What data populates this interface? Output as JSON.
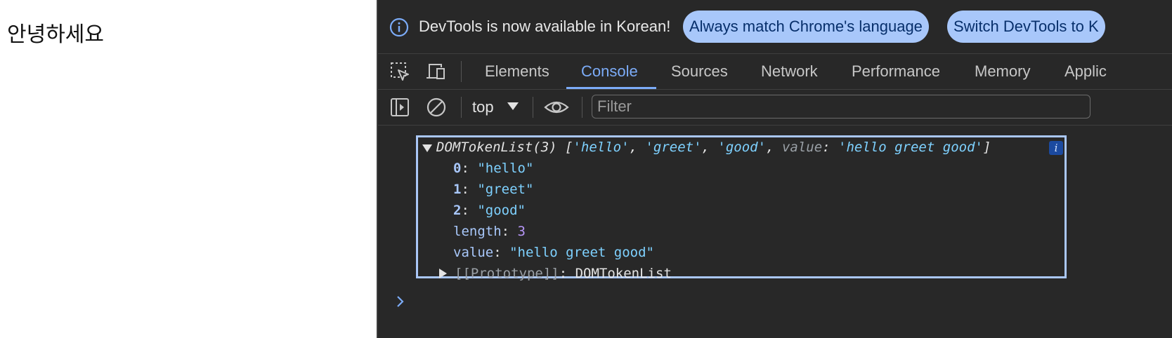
{
  "page": {
    "text": "안녕하세요"
  },
  "infobar": {
    "message": "DevTools is now available in Korean!",
    "button_match": "Always match Chrome's language",
    "button_switch": "Switch DevTools to K"
  },
  "tabs": [
    {
      "label": "Elements"
    },
    {
      "label": "Console"
    },
    {
      "label": "Sources"
    },
    {
      "label": "Network"
    },
    {
      "label": "Performance"
    },
    {
      "label": "Memory"
    },
    {
      "label": "Applic"
    }
  ],
  "active_tab": "Console",
  "console_toolbar": {
    "context": "top",
    "filter_placeholder": "Filter"
  },
  "console_entry": {
    "header": {
      "type": "DOMTokenList(3)",
      "open_bracket": " [",
      "item0": "'hello'",
      "item1": "'greet'",
      "item2": "'good'",
      "comma": ", ",
      "value_key": "value",
      "colon": ": ",
      "value_val": "'hello greet good'",
      "close_bracket": "]",
      "info_badge": "i"
    },
    "props": [
      {
        "key": "0",
        "value": "\"hello\""
      },
      {
        "key": "1",
        "value": "\"greet\""
      },
      {
        "key": "2",
        "value": "\"good\""
      },
      {
        "key": "length",
        "value": "3"
      },
      {
        "key": "value",
        "value": "\"hello greet good\""
      }
    ],
    "prototype": {
      "key": "[[Prototype]]",
      "value": "DOMTokenList"
    }
  },
  "colors": {
    "panel_bg": "#282828",
    "accent": "#7cacf8",
    "pill_bg": "#a8c7fa",
    "string": "#7ed1ff",
    "number": "#b696f7",
    "selection_border": "#aac7f7"
  },
  "icons": [
    "info-icon",
    "inspect-element-icon",
    "device-toolbar-icon",
    "sidebar-toggle-icon",
    "clear-console-icon",
    "dropdown-caret-icon",
    "eye-icon",
    "expand-triangle-icon",
    "collapsed-triangle-icon",
    "console-prompt-icon"
  ]
}
